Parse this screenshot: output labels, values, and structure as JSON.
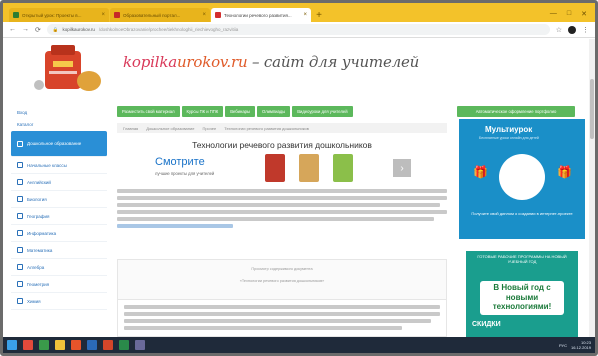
{
  "browser": {
    "tabs": [
      {
        "title": "Открытый урок: Проекты в...",
        "active": false,
        "favicon_color": "#2e7d32"
      },
      {
        "title": "Образовательный портал...",
        "active": false,
        "favicon_color": "#c62828"
      },
      {
        "title": "Технологии речевого развития...",
        "active": true,
        "favicon_color": "#d32f2f"
      }
    ],
    "new_tab": "+",
    "window_controls": [
      "—",
      "□",
      "✕"
    ],
    "url_domain": "kopilkaurokov.ru",
    "url_path": "/doshkolnoeObrazovanie/prochee/tiekhnologhii_riechievogho_razvitiia",
    "nav_back": "←",
    "nav_forward": "→",
    "nav_reload": "⟳",
    "star": "☆"
  },
  "site": {
    "brand_part1": "kopilka",
    "brand_part2": "urokov.ru",
    "brand_part3": " – сайт для учителей"
  },
  "sidebar": {
    "top_links": [
      "Вход",
      "Каталог"
    ],
    "items": [
      {
        "label": "Дошкольное образование",
        "active": true
      },
      {
        "label": "Начальные классы",
        "active": false
      },
      {
        "label": "Английский",
        "active": false
      },
      {
        "label": "Биология",
        "active": false
      },
      {
        "label": "География",
        "active": false
      },
      {
        "label": "Информатика",
        "active": false
      },
      {
        "label": "Математика",
        "active": false
      },
      {
        "label": "Алгебра",
        "active": false
      },
      {
        "label": "Геометрия",
        "active": false
      },
      {
        "label": "Химия",
        "active": false
      }
    ]
  },
  "nav": {
    "buttons": [
      "Разместить свой материал",
      "Курсы ПК и ППК",
      "Вебинары",
      "Олимпиады",
      "Видеоуроки для учителей"
    ],
    "right_button": "Автоматическое оформление портфолио"
  },
  "breadcrumb": [
    "Главная",
    "Дошкольное образование",
    "Прочее",
    "Технологии речевого развития дошкольников"
  ],
  "article": {
    "title": "Технологии речевого развития дошкольников"
  },
  "ad": {
    "headline": "Смотрите",
    "sub": "лучшие проекты для учителей",
    "next": "›"
  },
  "doc": {
    "caption_line1": "Просмотр содержимого документа",
    "caption_line2": "«Технологии речевого развития дошкольников»"
  },
  "promo": {
    "logo": "Мультиурок",
    "sub": "Бесплатные уроки онлайн для детей",
    "text": "Получите свой диплом о создании в интернет-проекте"
  },
  "banner2": {
    "top": "ГОТОВЫЕ РАБОЧИЕ ПРОГРАММЫ НА НОВЫЙ УЧЕБНЫЙ ГОД",
    "cta": "В Новый год с новыми технологиями!",
    "foot": "СКИДКИ"
  },
  "taskbar": {
    "time": "10:23",
    "date": "16.12.2019",
    "lang": "РУС"
  },
  "colors": {
    "tabstrip": "#f3c22a",
    "accent_green": "#5cb85c",
    "accent_blue": "#2a8fd6",
    "promo_blue": "#1a8fc8"
  }
}
